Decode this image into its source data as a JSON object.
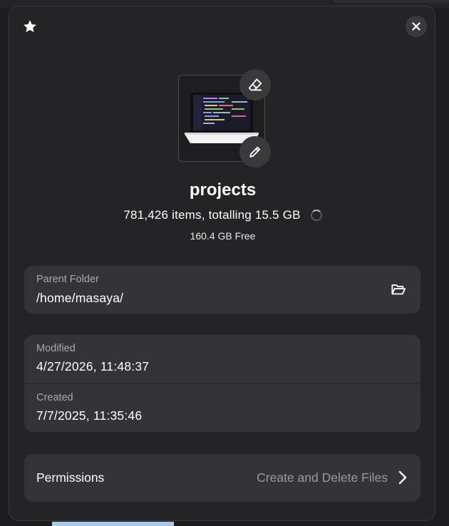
{
  "folder": {
    "name": "projects",
    "summary": "781,426 items, totalling 15.5 GB",
    "free": "160.4 GB Free"
  },
  "parent": {
    "label": "Parent Folder",
    "path": "/home/masaya/"
  },
  "dates": {
    "modified_label": "Modified",
    "modified_value": "4/27/2026, 11:48:37",
    "created_label": "Created",
    "created_value": "7/7/2025, 11:35:46"
  },
  "permissions": {
    "label": "Permissions",
    "value": "Create and Delete Files"
  },
  "icons": {
    "star": "star-icon",
    "close": "close-icon",
    "eraser": "eraser-icon",
    "pencil": "pencil-icon",
    "open_folder": "folder-open-icon",
    "chevron": "chevron-right-icon"
  },
  "colors": {
    "dialog_bg": "#242427",
    "card_bg": "#343438",
    "muted_text": "#a8a8ac"
  }
}
